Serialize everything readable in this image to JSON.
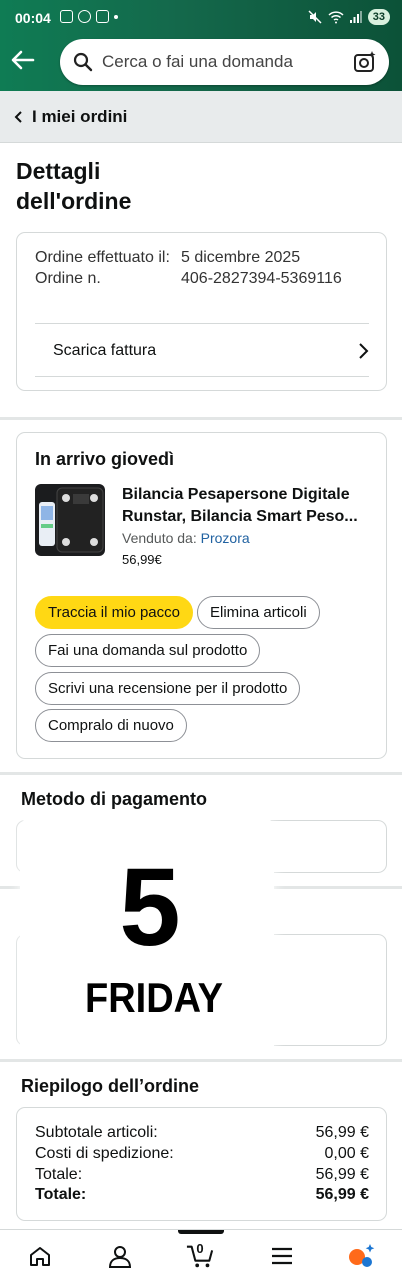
{
  "status_bar": {
    "time": "00:04",
    "battery": "33"
  },
  "header": {
    "search_placeholder": "Cerca o fai una domanda"
  },
  "breadcrumb": {
    "label": "I miei ordini"
  },
  "page": {
    "title": "Dettagli dell'ordine"
  },
  "order_info": {
    "placed_label": "Ordine effettuato il:",
    "placed_value": "5 dicembre 2025",
    "number_label": "Ordine n.",
    "number_value": "406-2827394-5369116",
    "invoice_label": "Scarica fattura"
  },
  "shipment": {
    "title": "In arrivo giovedì",
    "product_name": "Bilancia Pesapersone Digitale Runstar, Bilancia Smart Peso...",
    "sold_by_label": "Venduto da:",
    "seller": "Prozora",
    "price": "56,99€",
    "actions": {
      "track": "Traccia il mio pacco",
      "delete": "Elimina articoli",
      "ask": "Fai una domanda sul prodotto",
      "review": "Scrivi una recensione per il prodotto",
      "buy_again": "Compralo di nuovo"
    }
  },
  "payment": {
    "title": "Metodo di pagamento"
  },
  "overlay_calendar": {
    "day_number": "5",
    "weekday": "FRIDAY"
  },
  "summary": {
    "title": "Riepilogo dell’ordine",
    "rows": [
      {
        "label": "Subtotale articoli:",
        "value": "56,99 €"
      },
      {
        "label": "Costi di spedizione:",
        "value": "0,00 €"
      },
      {
        "label": "Totale:",
        "value": "56,99 €"
      }
    ],
    "grand_total": {
      "label": "Totale:",
      "value": "56,99 €"
    }
  },
  "bottom_nav": {
    "cart_count": "0"
  },
  "colors": {
    "header_green": "#0f7c54",
    "track_yellow": "#ffd814",
    "link_blue": "#2162a1"
  }
}
